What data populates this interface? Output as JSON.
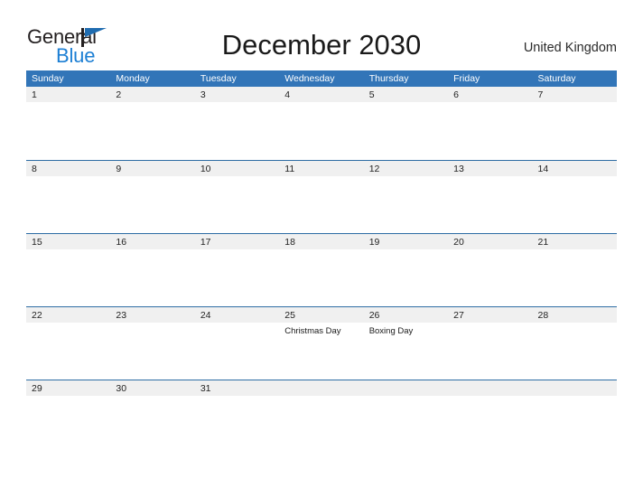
{
  "branding": {
    "logo_text_primary": "General",
    "logo_text_secondary": "Blue"
  },
  "header": {
    "title": "December 2030",
    "country": "United Kingdom"
  },
  "colors": {
    "header_blue": "#3275b8",
    "row_divider_blue": "#2e6da4",
    "date_band_gray": "#f0f0f0",
    "logo_blue": "#1c7fd4",
    "logo_dark": "#231f20",
    "page_background": "#ffffff"
  },
  "calendar": {
    "weekdays": [
      "Sunday",
      "Monday",
      "Tuesday",
      "Wednesday",
      "Thursday",
      "Friday",
      "Saturday"
    ],
    "weeks": [
      [
        {
          "day": "1",
          "events": []
        },
        {
          "day": "2",
          "events": []
        },
        {
          "day": "3",
          "events": []
        },
        {
          "day": "4",
          "events": []
        },
        {
          "day": "5",
          "events": []
        },
        {
          "day": "6",
          "events": []
        },
        {
          "day": "7",
          "events": []
        }
      ],
      [
        {
          "day": "8",
          "events": []
        },
        {
          "day": "9",
          "events": []
        },
        {
          "day": "10",
          "events": []
        },
        {
          "day": "11",
          "events": []
        },
        {
          "day": "12",
          "events": []
        },
        {
          "day": "13",
          "events": []
        },
        {
          "day": "14",
          "events": []
        }
      ],
      [
        {
          "day": "15",
          "events": []
        },
        {
          "day": "16",
          "events": []
        },
        {
          "day": "17",
          "events": []
        },
        {
          "day": "18",
          "events": []
        },
        {
          "day": "19",
          "events": []
        },
        {
          "day": "20",
          "events": []
        },
        {
          "day": "21",
          "events": []
        }
      ],
      [
        {
          "day": "22",
          "events": []
        },
        {
          "day": "23",
          "events": []
        },
        {
          "day": "24",
          "events": []
        },
        {
          "day": "25",
          "events": [
            "Christmas Day"
          ]
        },
        {
          "day": "26",
          "events": [
            "Boxing Day"
          ]
        },
        {
          "day": "27",
          "events": []
        },
        {
          "day": "28",
          "events": []
        }
      ],
      [
        {
          "day": "29",
          "events": []
        },
        {
          "day": "30",
          "events": []
        },
        {
          "day": "31",
          "events": []
        },
        {
          "day": "",
          "events": []
        },
        {
          "day": "",
          "events": []
        },
        {
          "day": "",
          "events": []
        },
        {
          "day": "",
          "events": []
        }
      ]
    ]
  }
}
